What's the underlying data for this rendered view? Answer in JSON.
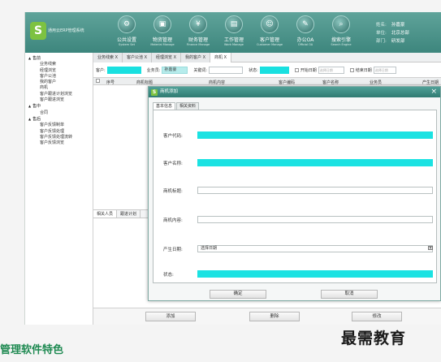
{
  "header": {
    "app_name": "通用云ERP管理系统",
    "logo_glyph": "S",
    "nav": [
      {
        "label": "公共设置",
        "sub": "System Set",
        "icon": "settings-icon",
        "glyph": "⚙"
      },
      {
        "label": "物资管理",
        "sub": "Material Manage",
        "icon": "box-icon",
        "glyph": "▣"
      },
      {
        "label": "财务管理",
        "sub": "Finance Manage",
        "icon": "finance-icon",
        "glyph": "¥"
      },
      {
        "label": "工作管理",
        "sub": "Work Manage",
        "icon": "briefcase-icon",
        "glyph": "▤"
      },
      {
        "label": "客户管理",
        "sub": "Customer Manage",
        "icon": "customer-icon",
        "glyph": "☺"
      },
      {
        "label": "办公OA",
        "sub": "Official OA",
        "icon": "office-icon",
        "glyph": "✎"
      },
      {
        "label": "搜索引擎",
        "sub": "Search Engine",
        "icon": "search-icon",
        "glyph": "⌕"
      }
    ],
    "user": {
      "name_label": "姓名:",
      "name": "孙嘉豪",
      "unit_label": "单位:",
      "unit": "北京总部",
      "dept_label": "部门:",
      "dept": "研发部"
    }
  },
  "sidebar": {
    "groups": [
      {
        "label": "售前",
        "items": [
          "业务线索",
          "经理浏览",
          "客户公池",
          "我的客户",
          "商机",
          "客户跟进计划浏览",
          "客户跟进浏览"
        ]
      },
      {
        "label": "售中",
        "items": [
          "合同"
        ]
      },
      {
        "label": "售后",
        "items": [
          "客户反馈制单",
          "客户反馈处理",
          "客户反馈处理流转",
          "客户反馈浏览"
        ]
      }
    ]
  },
  "tabs": [
    "业务线索 X",
    "客户公池 X",
    "经理浏览 X",
    "我的客户 X",
    "商机 X"
  ],
  "filter": {
    "customer_label": "客户:",
    "salesperson_label": "业务员:",
    "salesperson_value": "孙嘉豪",
    "keyword_label": "关键词:",
    "status_label": "状态:",
    "start_date_label": "开始日期",
    "end_date_label": "结束日期",
    "date_placeholder": "选择日期"
  },
  "grid": {
    "columns": [
      "序号",
      "商机标题",
      "商机内容",
      "客户编码",
      "客户名称",
      "业务员",
      "产生日期"
    ]
  },
  "subtabs": [
    "相关人员",
    "跟进计划"
  ],
  "bottom_buttons": [
    "添加",
    "删除",
    "修改"
  ],
  "modal": {
    "title": "商机添加",
    "close": "×",
    "tabs": [
      "基本信息",
      "相关资料"
    ],
    "fields": [
      {
        "label": "客户代码:",
        "value": "",
        "style": "cyan"
      },
      {
        "label": "客户名称:",
        "value": "",
        "style": "cyan"
      },
      {
        "label": "商机标题:",
        "value": "",
        "style": "plain"
      },
      {
        "label": "商机内容:",
        "value": "",
        "style": "plain"
      },
      {
        "label": "产生日期:",
        "value": "选择日期",
        "style": "date"
      },
      {
        "label": "状态:",
        "value": "",
        "style": "cyan"
      }
    ],
    "ok_label": "确定",
    "cancel_label": "取消"
  },
  "caption": "管理软件特色",
  "watermark": "最需教育",
  "colors": {
    "header": "#3d867d",
    "highlight": "#19e0e0",
    "caption": "#1f8a52",
    "logo": "#7dc241"
  }
}
